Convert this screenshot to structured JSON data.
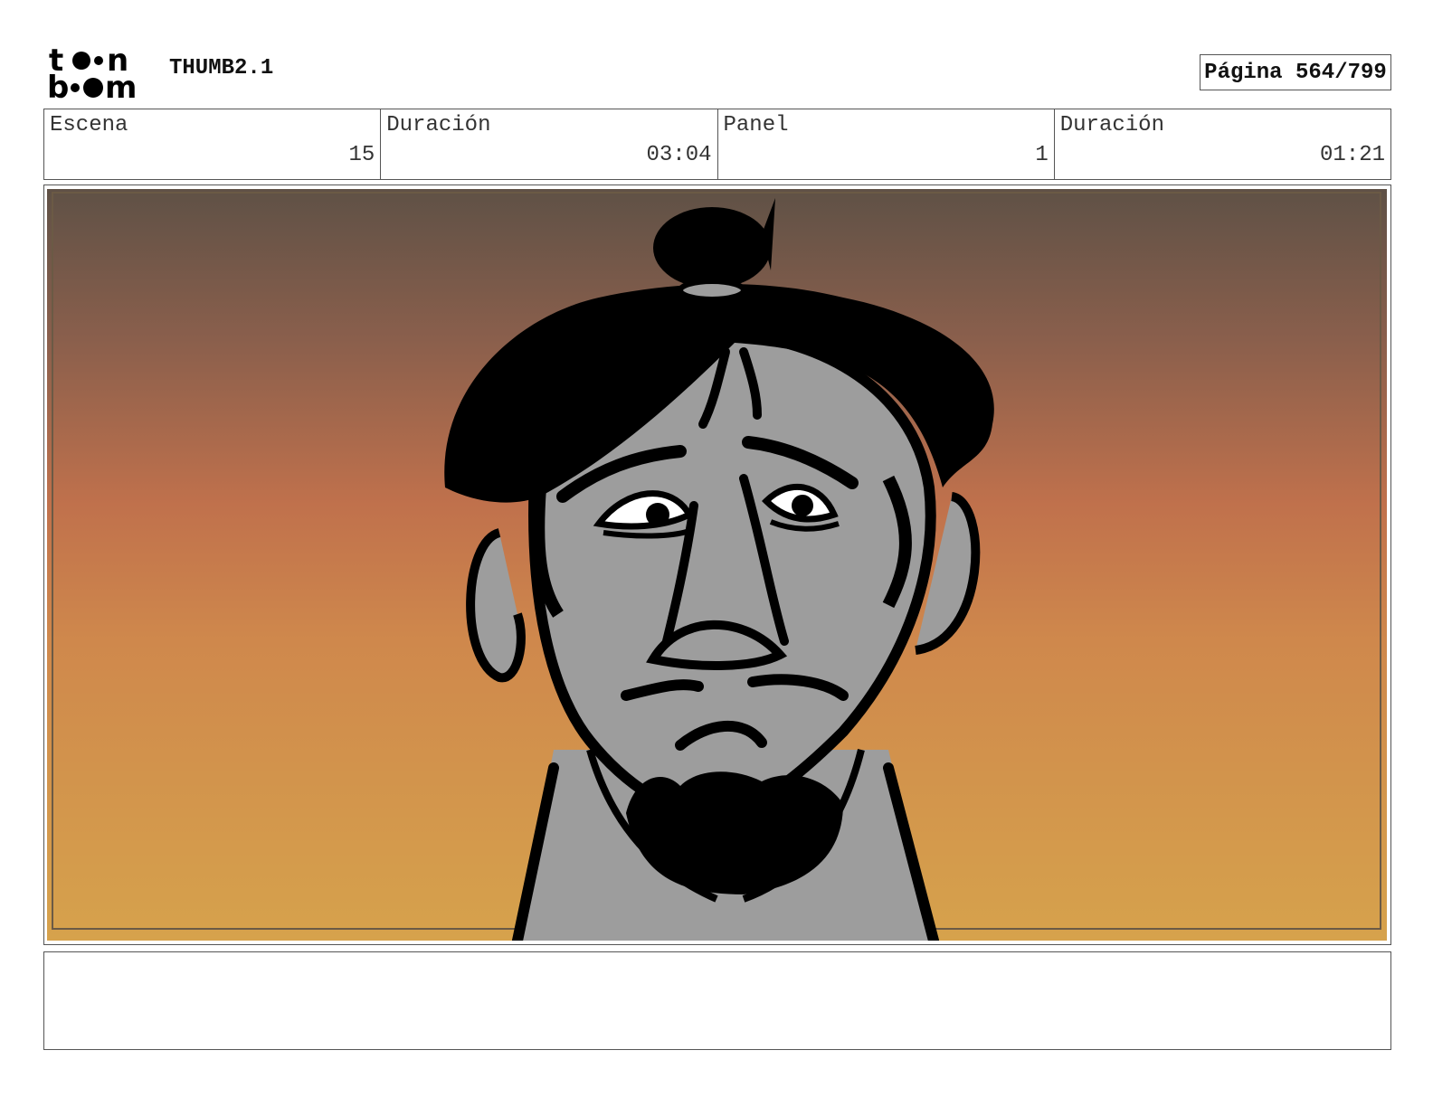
{
  "header": {
    "logo_text": "toon boom",
    "doc_title": "THUMB2.1",
    "page_label": "Página 564/799"
  },
  "info": [
    {
      "label": "Escena",
      "value": "15"
    },
    {
      "label": "Duración",
      "value": "03:04"
    },
    {
      "label": "Panel",
      "value": "1"
    },
    {
      "label": "Duración",
      "value": "01:21"
    }
  ],
  "panel": {
    "description": "",
    "colors": {
      "sky_top": "#5f5146",
      "sky_mid": "#b8684a",
      "sky_low": "#d08a4c",
      "sky_bottom": "#d6a24c",
      "skin": "#9d9d9d",
      "ink": "#000000"
    }
  },
  "notes": {
    "text": ""
  }
}
